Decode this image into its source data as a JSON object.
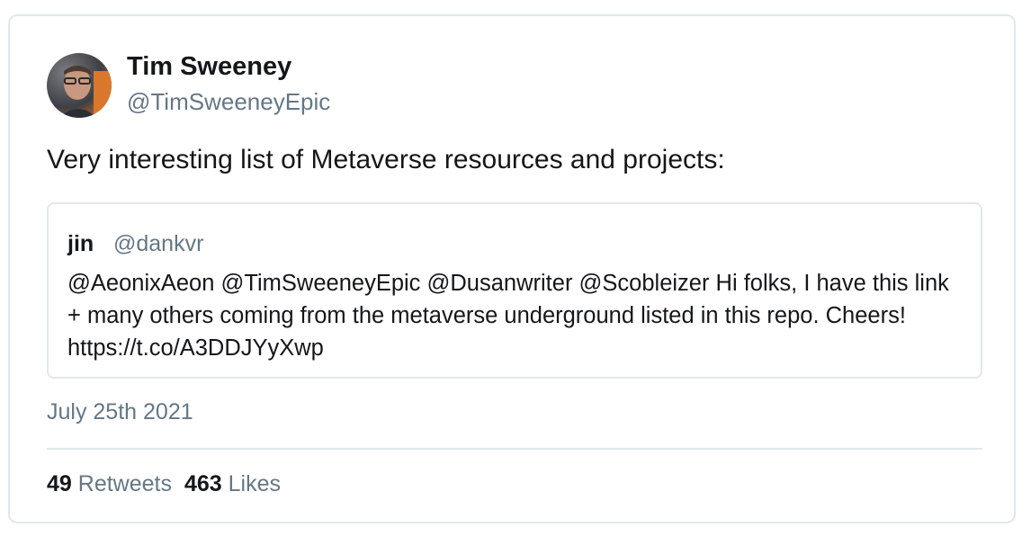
{
  "tweet": {
    "author": {
      "name": "Tim Sweeney",
      "handle": "@TimSweeneyEpic"
    },
    "text": "Very interesting list of Metaverse resources and projects:",
    "quoted": {
      "name": "jin",
      "handle": "@dankvr",
      "text": "@AeonixAeon @TimSweeneyEpic @Dusanwriter @Scobleizer Hi folks, I have this link + many others coming from the metaverse underground listed in this repo. Cheers! https://t.co/A3DDJYyXwp"
    },
    "date": "July 25th 2021",
    "stats": {
      "retweets_count": "49",
      "retweets_label": "Retweets",
      "likes_count": "463",
      "likes_label": "Likes"
    }
  },
  "colors": {
    "primary_text": "#14171a",
    "secondary_text": "#657786",
    "border": "#e1e8ed"
  }
}
